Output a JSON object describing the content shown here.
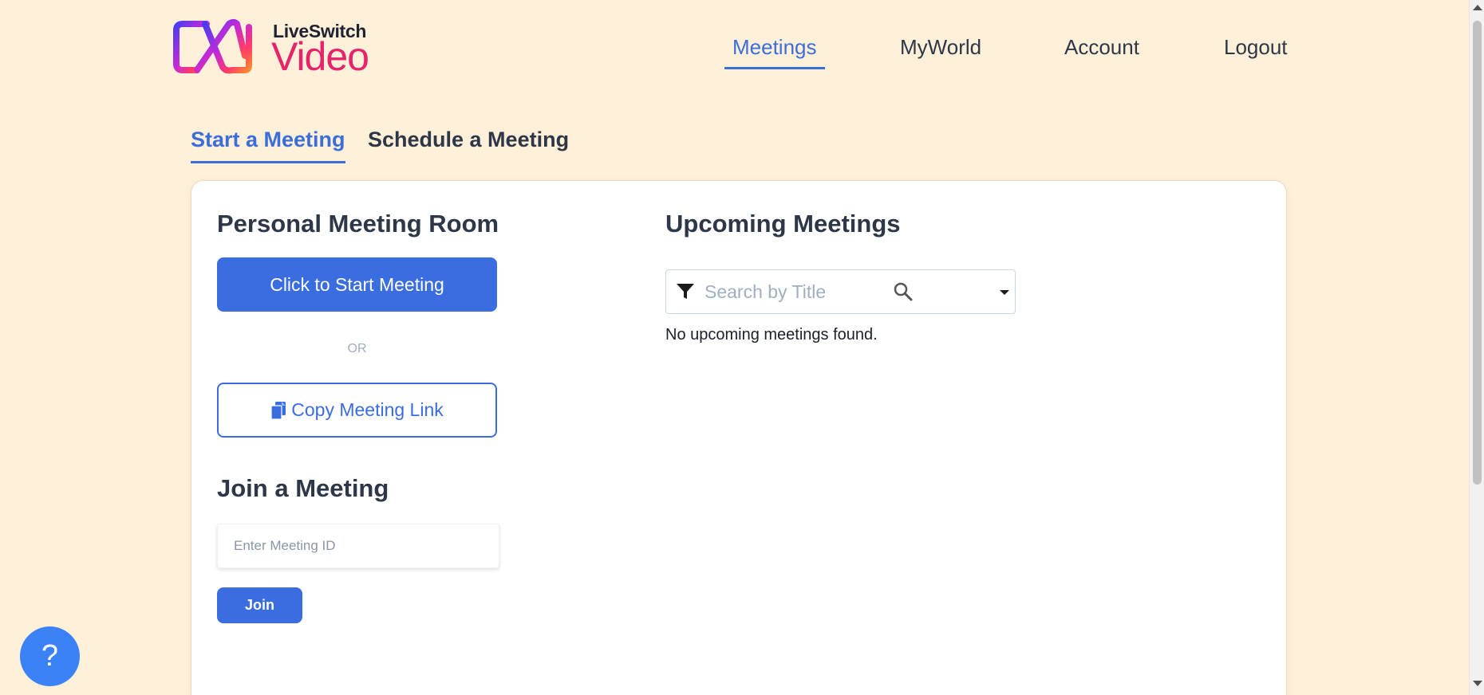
{
  "brand": {
    "top": "LiveSwitch",
    "main": "Video"
  },
  "nav": {
    "items": [
      {
        "label": "Meetings",
        "active": true
      },
      {
        "label": "MyWorld",
        "active": false
      },
      {
        "label": "Account",
        "active": false
      },
      {
        "label": "Logout",
        "active": false
      }
    ]
  },
  "tabs": [
    {
      "label": "Start a Meeting",
      "active": true
    },
    {
      "label": "Schedule a Meeting",
      "active": false
    }
  ],
  "personal_room": {
    "heading": "Personal Meeting Room",
    "start_label": "Click to Start Meeting",
    "or_label": "OR",
    "copy_label": "Copy Meeting Link"
  },
  "join": {
    "heading": "Join a Meeting",
    "input_placeholder": "Enter Meeting ID",
    "input_value": "",
    "button_label": "Join"
  },
  "upcoming": {
    "heading": "Upcoming Meetings",
    "search_placeholder": "Search by Title",
    "empty_text": "No upcoming meetings found."
  },
  "help": {
    "label": "?"
  },
  "colors": {
    "background": "#fff0d9",
    "accent": "#3a6ddf",
    "brand_pink": "#e6236b",
    "help_button": "#3b82f6"
  }
}
